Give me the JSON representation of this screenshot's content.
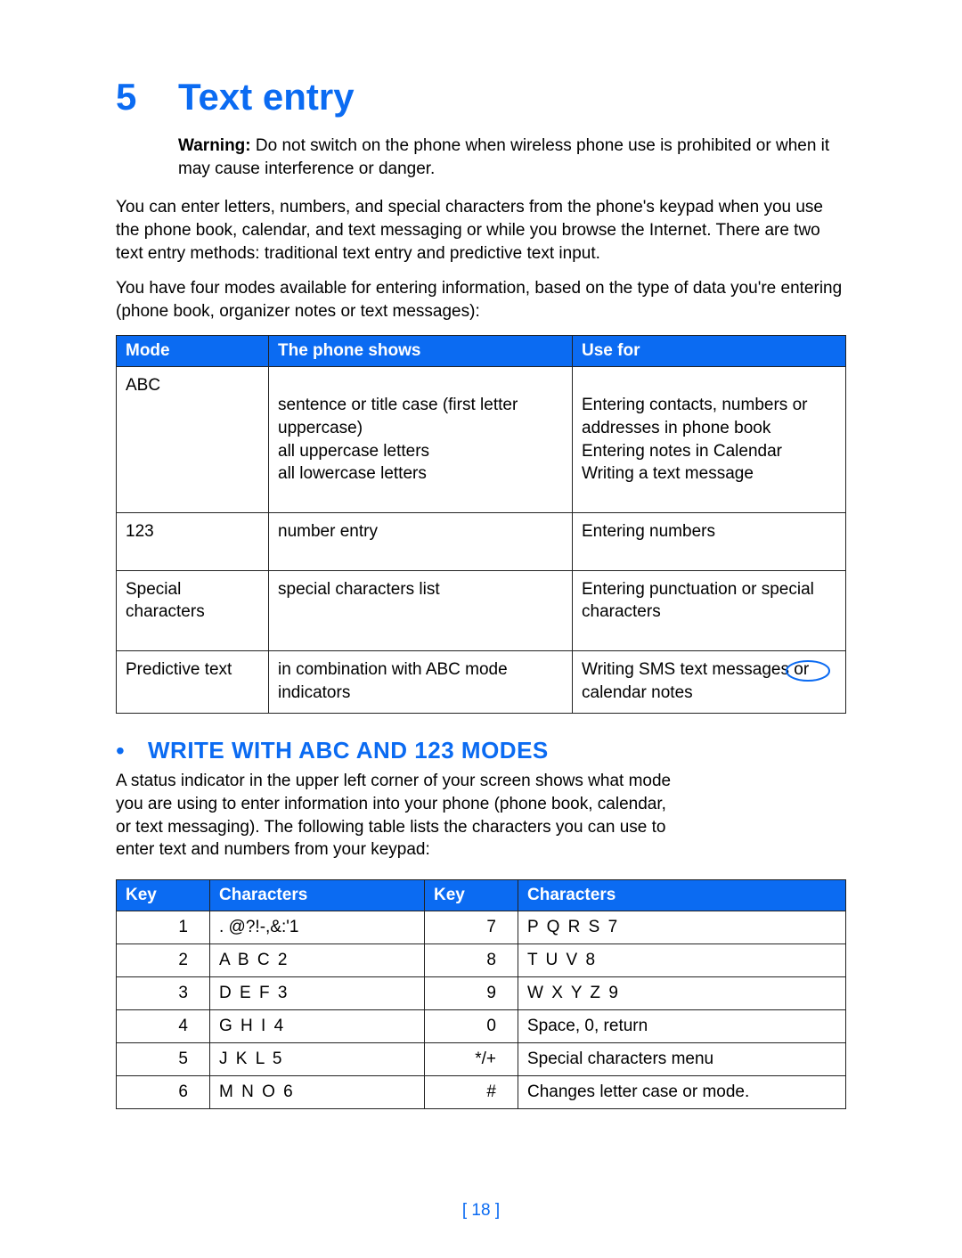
{
  "chapter": {
    "number": "5",
    "title": "Text entry"
  },
  "warning": {
    "label": "Warning:",
    "text": " Do not switch on the phone when wireless phone use is prohibited or when it may cause interference or danger."
  },
  "intro1": "You can enter letters, numbers, and special characters from the phone's keypad when you use the phone book, calendar, and text messaging or while you browse the Internet. There are two text entry methods: traditional text entry and predictive text input.",
  "intro2": "You have four modes available for entering information, based on the type of data you're entering (phone book, organizer notes or text messages):",
  "modes_table": {
    "headers": [
      "Mode",
      "The phone shows",
      "Use for"
    ],
    "rows": [
      {
        "mode": "ABC",
        "shows": "sentence or title case (first letter uppercase)\nall uppercase letters\nall lowercase letters",
        "use": "Entering contacts, numbers or addresses in phone book\nEntering notes in Calendar\nWriting a text message"
      },
      {
        "mode": "123",
        "shows": "number entry",
        "use": "Entering numbers"
      },
      {
        "mode": "Special characters",
        "shows": "special characters list",
        "use": "Entering punctuation or special characters"
      },
      {
        "mode": "Predictive text",
        "shows": "in combination with ABC mode indicators",
        "use": "Writing SMS text messages or calendar notes"
      }
    ]
  },
  "section": {
    "heading": "WRITE WITH ABC AND 123 MODES",
    "text": "A status indicator in the upper left corner of your screen shows what mode you are using to enter information into your phone (phone book, calendar, or text messaging). The following table lists the characters you can use to enter text and numbers from your keypad:"
  },
  "keys_table": {
    "headers": [
      "Key",
      "Characters",
      "Key",
      "Characters"
    ],
    "rows": [
      {
        "k1": "1",
        "c1": ". @?!-,&:'1",
        "c1ls": false,
        "k2": "7",
        "c2": "P Q R S 7",
        "c2ls": true
      },
      {
        "k1": "2",
        "c1": "A B C 2",
        "c1ls": true,
        "k2": "8",
        "c2": "T U V 8",
        "c2ls": true
      },
      {
        "k1": "3",
        "c1": "D E F 3",
        "c1ls": true,
        "k2": "9",
        "c2": "W X Y Z 9",
        "c2ls": true
      },
      {
        "k1": "4",
        "c1": "G H I 4",
        "c1ls": true,
        "k2": "0",
        "c2": "Space, 0, return",
        "c2ls": false
      },
      {
        "k1": "5",
        "c1": "J K L 5",
        "c1ls": true,
        "k2": "*/+",
        "c2": "Special characters menu",
        "c2ls": false
      },
      {
        "k1": "6",
        "c1": "M N O 6",
        "c1ls": true,
        "k2": "#",
        "c2": "Changes letter case or mode.",
        "c2ls": false
      }
    ]
  },
  "page_number": "[ 18 ]"
}
